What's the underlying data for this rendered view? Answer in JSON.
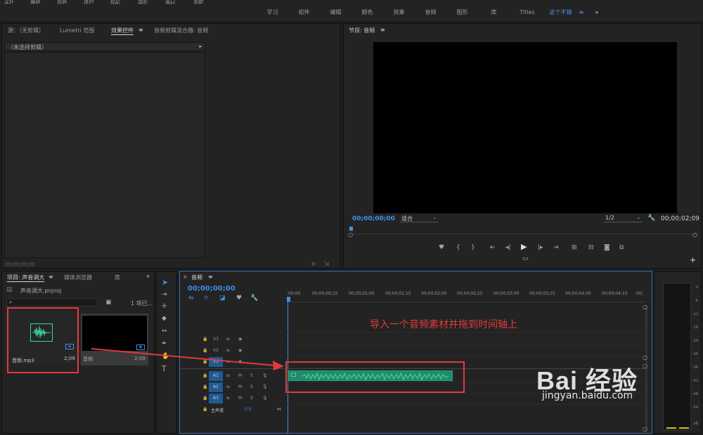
{
  "menubar": {
    "items": [
      "文件(F)",
      "编辑(E)",
      "剪辑(C)",
      "序列(S)",
      "标记(M)",
      "图形(G)",
      "窗口(W)",
      "帮助(H)"
    ]
  },
  "workspaces": {
    "tabs": [
      "学习",
      "组件",
      "编辑",
      "颜色",
      "效果",
      "音频",
      "图形",
      "库",
      "Titles",
      "这个不错"
    ],
    "active": "这个不错",
    "menu_icon": "≡",
    "overflow_icon": "»"
  },
  "source_panel": {
    "tabs": [
      "源：（无剪辑）",
      "Lumetri 范围",
      "效果控件",
      "音频剪辑混合器: 音频"
    ],
    "active_tab": "效果控件",
    "no_clip": "（未选择剪辑）",
    "timecode": "00;00;00;00"
  },
  "program_panel": {
    "title": "节目: 音频",
    "timecode_left": "00;00;00;00",
    "fit": "适合",
    "quality": "1/2",
    "timecode_right": "00;00;02;09"
  },
  "project_panel": {
    "tabs": [
      "项目: 声音调大",
      "媒体浏览器",
      "库"
    ],
    "file": "声音调大.prproj",
    "item_count": "1 项已...",
    "items": [
      {
        "name": "音频.mp3",
        "duration": "2;09"
      },
      {
        "name": "音频",
        "duration": "2;09"
      }
    ]
  },
  "timeline": {
    "sequence_name": "音频",
    "timecode": "00;00;00;00",
    "ruler": [
      ":00;00",
      "00;00;00;15",
      "00;00;01;00",
      "00;00;01;15",
      "00;00;02;00",
      "00;00;02;15",
      "00;00;03;00",
      "00;00;03;15",
      "00;00;04;00",
      "00;00;04;15",
      "00;"
    ],
    "video_tracks": [
      "V3",
      "V2",
      "V1"
    ],
    "audio_tracks": [
      "A1",
      "A2",
      "A3"
    ],
    "master_label": "主声道",
    "master_value": "0.0",
    "track_buttons": {
      "mute": "M",
      "solo": "S"
    },
    "annotation": "导入一个音频素材并拖到时间轴上"
  },
  "meters": {
    "scale": [
      "0",
      "-6",
      "-12",
      "-18",
      "-24",
      "-30",
      "-36",
      "-42",
      "-48",
      "-54",
      "dB"
    ]
  },
  "watermark": {
    "text": "Bai 经验",
    "url": "jingyan.baidu.com"
  },
  "colors": {
    "accent": "#3f8fe6",
    "annotation": "#e23a3a",
    "audio_clip": "#1f8c6a",
    "waveform": "#3fd39a",
    "track_target": "#1f5a92"
  }
}
